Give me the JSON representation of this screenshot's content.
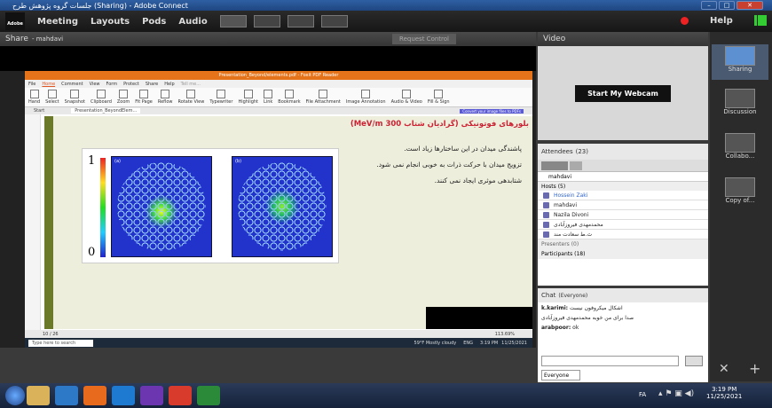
{
  "titlebar": {
    "title": "جلسات گروه پژوهش طرح    (Sharing) - Adobe Connect"
  },
  "menu": {
    "logo": "Adobe",
    "items": [
      "Meeting",
      "Layouts",
      "Pods",
      "Audio"
    ],
    "help": "Help"
  },
  "share": {
    "header": "Share",
    "presenter": "- mahdavi",
    "request": "Request Control"
  },
  "pdf": {
    "window_title": "Presentation_Beyond/elements.pdf - Foxit PDF Reader",
    "tabs": [
      "File",
      "Home",
      "Comment",
      "View",
      "Form",
      "Protect",
      "Share",
      "Help"
    ],
    "tell_me": "Tell me...",
    "ribbon": [
      "Hand",
      "Select",
      "Snapshot",
      "Clipboard",
      "Zoom",
      "Fit Page",
      "Reflow",
      "Rotate View",
      "Typewriter",
      "Highlight",
      "Link",
      "Bookmark",
      "File Attachment",
      "Image Annotation",
      "Audio & Video",
      "Fill & Sign"
    ],
    "doc_tab": "Presentation_BeyondElem...",
    "start_tab": "Start",
    "convert": "Convert your image files to PDFs",
    "page": "10 / 26",
    "zoom": "113.69%"
  },
  "slide": {
    "title": "بلورهای فوتونیکی (گرادیان شتاب 300 MeV/m)",
    "bullets": [
      "پاشندگی میدان در این ساختارها زیاد است.",
      "تزویج میدان با حرکت ذرات به خوبی انجام نمی شود.",
      "شتابدهی موثری ایجاد نمی کنند."
    ],
    "scale_top": "1",
    "scale_bottom": "0",
    "panel_a": "(a)",
    "panel_b": "(b)"
  },
  "inner_taskbar": {
    "search": "Type here to search",
    "weather": "59°F  Mostly cloudy",
    "lang": "ENG",
    "time": "3:19 PM",
    "date": "11/25/2021"
  },
  "video": {
    "header": "Video",
    "webcam": "Start My Webcam"
  },
  "attendees": {
    "header": "Attendees",
    "count": "(23)",
    "search_value": "mahdavi",
    "hosts": "Hosts (5)",
    "host_list": [
      "Hossein Zaki",
      "mahdavi",
      "Nazila Divoni",
      "محمدمهدی فیروزآبادی",
      "ث.ط سعادت مند"
    ],
    "presenters": "Presenters (0)",
    "participants": "Participants (18)"
  },
  "chat": {
    "header": "Chat",
    "scope": "(Everyone)",
    "messages": [
      {
        "sender": "k.karimi:",
        "text": "اشکال میکروفون نیست"
      },
      {
        "sender": "",
        "text": "صدا برای من خوبه محمدمهدی فیروزآبادی"
      },
      {
        "sender": "arabpoor:",
        "text": "ok"
      }
    ],
    "target": "Everyone"
  },
  "sidebar": {
    "items": [
      "Sharing",
      "Discussion",
      "Collabo...",
      "Copy of..."
    ]
  },
  "taskbar": {
    "lang": "FA",
    "time": "3:19 PM",
    "date": "11/25/2021"
  }
}
